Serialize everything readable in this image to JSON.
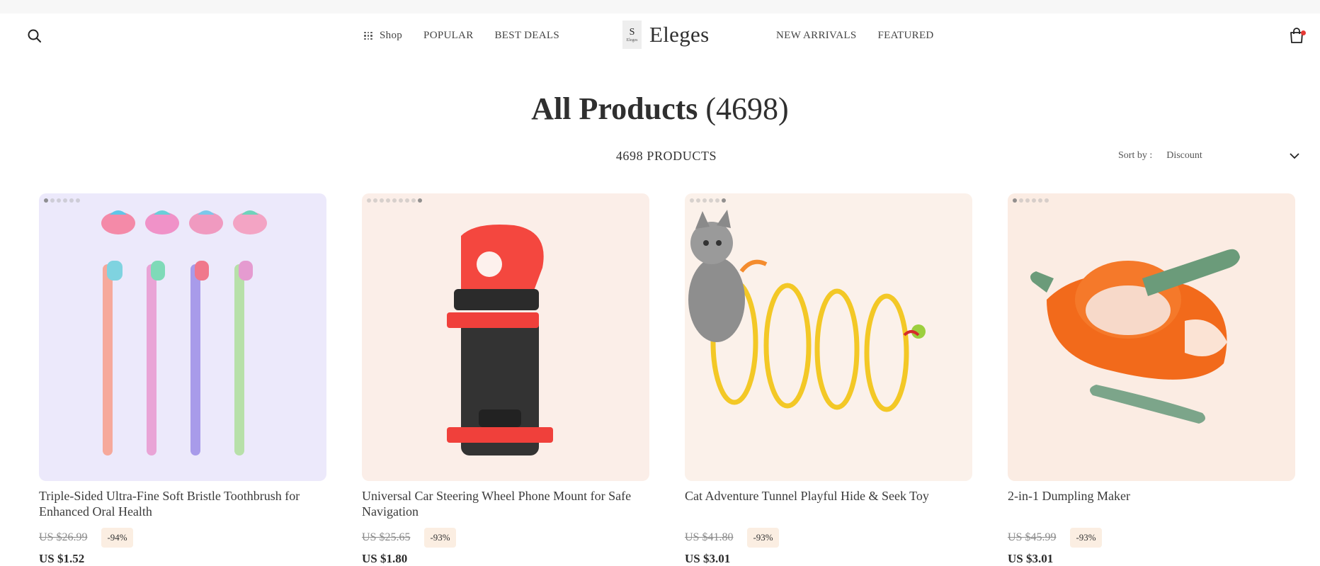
{
  "nav": {
    "search_icon": "search-icon",
    "shop_label": "Shop",
    "popular_label": "POPULAR",
    "best_deals_label": "BEST DEALS",
    "brand_logo_text": "Eleges",
    "brand_name": "Eleges",
    "new_arrivals_label": "NEW ARRIVALS",
    "featured_label": "FEATURED",
    "cart_icon": "shopping-bag-icon",
    "cart_badge_color": "#e53935"
  },
  "page": {
    "title": "All Products",
    "title_count": "(4698)",
    "products_count": "4698 PRODUCTS",
    "sort_label": "Sort by :",
    "sort_value": "Discount"
  },
  "products": [
    {
      "title": "Triple-Sided Ultra-Fine Soft Bristle Toothbrush for Enhanced Oral Health",
      "old_price": "US $26.99",
      "discount": "-94%",
      "price": "US $1.52",
      "bg": "#ece9fb",
      "image_dots": 6,
      "active_dot": 0
    },
    {
      "title": "Universal Car Steering Wheel Phone Mount for Safe Navigation",
      "old_price": "US $25.65",
      "discount": "-93%",
      "price": "US $1.80",
      "bg": "#fbeee8",
      "image_dots": 9,
      "active_dot": 8
    },
    {
      "title": "Cat Adventure Tunnel Playful Hide & Seek Toy",
      "old_price": "US $41.80",
      "discount": "-93%",
      "price": "US $3.01",
      "bg": "#fbf1ea",
      "image_dots": 6,
      "active_dot": 5
    },
    {
      "title": "2-in-1 Dumpling Maker",
      "old_price": "US $45.99",
      "discount": "-93%",
      "price": "US $3.01",
      "bg": "#fbece3",
      "image_dots": 6,
      "active_dot": 0
    }
  ]
}
